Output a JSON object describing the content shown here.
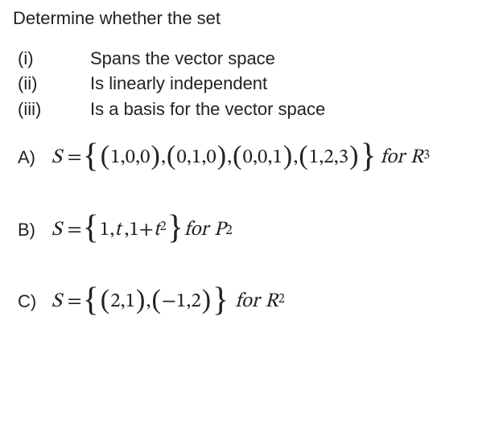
{
  "title": "Determine whether the set",
  "criteria": [
    {
      "num": "(i)",
      "text": "Spans the vector space"
    },
    {
      "num": "(ii)",
      "text": "Is linearly independent"
    },
    {
      "num": "(iii)",
      "text": "Is a basis for the vector space"
    }
  ],
  "problems": {
    "A": {
      "label": "A)",
      "set_elements": [
        "(1,0,0)",
        "(0,1,0)",
        "(0,0,1)",
        "(1,2,3)"
      ],
      "space": "R^3",
      "display": {
        "prefix_S": "S",
        "equals": "=",
        "for": "for",
        "R": "R",
        "exp": "3"
      }
    },
    "B": {
      "label": "B)",
      "set_elements": [
        "1",
        "t",
        "1+t^2"
      ],
      "space": "P_2",
      "display": {
        "prefix_S": "S",
        "equals": "=",
        "one": "1",
        "t1": "t",
        "one2": "1",
        "plus": "+",
        "t2": "t",
        "exp2": "2",
        "for": "for",
        "P": "P",
        "sub2": "2",
        "comma": ","
      }
    },
    "C": {
      "label": "C)",
      "set_elements": [
        "(2,1)",
        "(-1,2)"
      ],
      "space": "R^2",
      "display": {
        "prefix_S": "S",
        "equals": "=",
        "v1": "2,1",
        "v2a": "−",
        "v2b": "1,2",
        "for": "for",
        "R": "R",
        "exp": "2",
        "comma": ","
      }
    }
  }
}
